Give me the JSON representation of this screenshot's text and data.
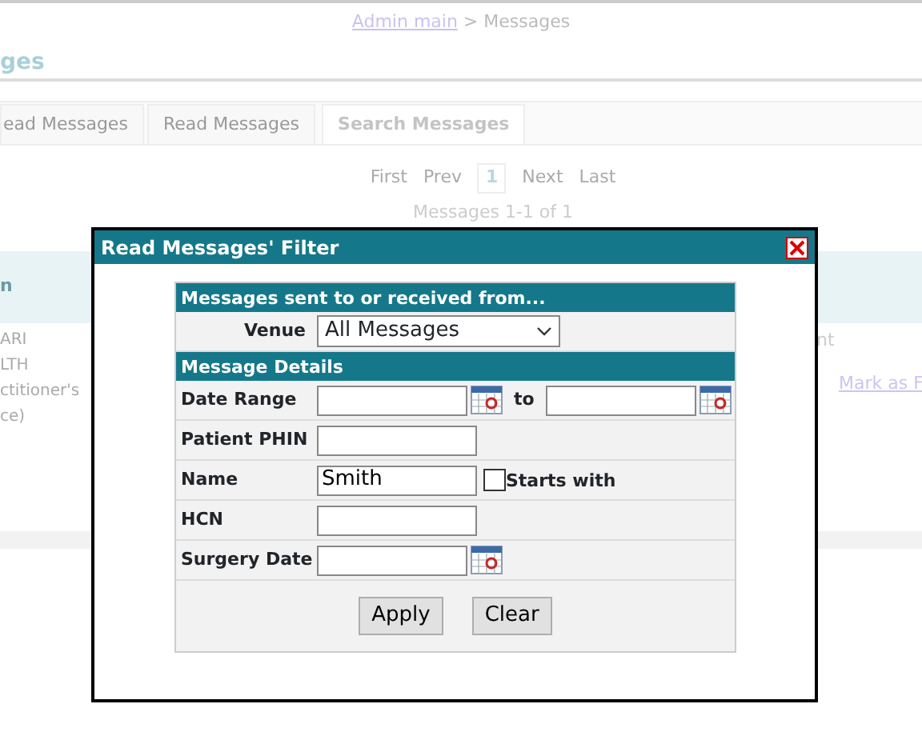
{
  "breadcrumb": {
    "link": "Admin main",
    "separator": ">",
    "current": "Messages"
  },
  "page_title": "ges",
  "tabs": [
    {
      "label": "ead Messages",
      "selected": false
    },
    {
      "label": "Read Messages",
      "selected": false
    },
    {
      "label": "Search Messages",
      "selected": true
    }
  ],
  "pager": {
    "items": [
      {
        "label": "First",
        "selected": false
      },
      {
        "label": "Prev",
        "selected": false
      },
      {
        "label": "1",
        "selected": true
      },
      {
        "label": "Next",
        "selected": false
      },
      {
        "label": "Last",
        "selected": false
      }
    ],
    "summary": "Messages 1-1 of 1"
  },
  "table": {
    "column_1": "n",
    "row": {
      "cell_1": [
        "ARI",
        "LTH",
        "ctitioner's",
        "ce)"
      ],
      "cell_2": "nt",
      "link": "Mark as F"
    }
  },
  "dialog": {
    "title": "Read Messages' Filter",
    "sections": [
      {
        "heading": "Messages sent to or received from...",
        "fields": [
          {
            "kind": "select",
            "label": "Venue",
            "value": "All Messages"
          }
        ]
      },
      {
        "heading": "Message Details",
        "fields": [
          {
            "kind": "date_range",
            "label": "Date Range",
            "separator": "to"
          },
          {
            "kind": "text",
            "label": "Patient PHIN"
          },
          {
            "kind": "text_check",
            "label": "Name",
            "value": "Smith",
            "check_label": "Starts with",
            "checked": false
          },
          {
            "kind": "text",
            "label": "HCN"
          },
          {
            "kind": "date",
            "label": "Surgery Date"
          }
        ]
      }
    ],
    "buttons": [
      "Apply",
      "Clear"
    ]
  }
}
